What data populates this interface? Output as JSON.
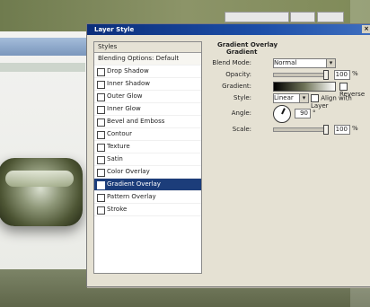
{
  "bg": {
    "field_left": "",
    "field_mid": "",
    "field_right": ""
  },
  "dialog": {
    "title": "Layer Style",
    "close_symbol": "×",
    "left": {
      "header": "Styles",
      "top_item": "Blending Options: Default",
      "items": [
        {
          "label": "Drop Shadow",
          "checked": false
        },
        {
          "label": "Inner Shadow",
          "checked": false
        },
        {
          "label": "Outer Glow",
          "checked": false
        },
        {
          "label": "Inner Glow",
          "checked": false
        },
        {
          "label": "Bevel and Emboss",
          "checked": false
        },
        {
          "label": "Contour",
          "checked": false
        },
        {
          "label": "Texture",
          "checked": false
        },
        {
          "label": "Satin",
          "checked": false
        },
        {
          "label": "Color Overlay",
          "checked": false
        },
        {
          "label": "Gradient Overlay",
          "checked": true,
          "selected": true
        },
        {
          "label": "Pattern Overlay",
          "checked": false
        },
        {
          "label": "Stroke",
          "checked": false
        }
      ]
    },
    "right": {
      "section": "Gradient Overlay",
      "subsection": "Gradient",
      "rows": {
        "blend_mode": {
          "label": "Blend Mode:",
          "value": "Normal"
        },
        "opacity": {
          "label": "Opacity:",
          "value": "100",
          "unit": "%",
          "level": 1
        },
        "gradient": {
          "label": "Gradient:",
          "reverse_label": "Reverse"
        },
        "style": {
          "label": "Style:",
          "value": "Linear",
          "align_label": "Align with Layer"
        },
        "angle": {
          "label": "Angle:",
          "value": "90",
          "unit": "°"
        },
        "scale": {
          "label": "Scale:",
          "value": "100",
          "unit": "%",
          "level": 1
        }
      }
    }
  }
}
